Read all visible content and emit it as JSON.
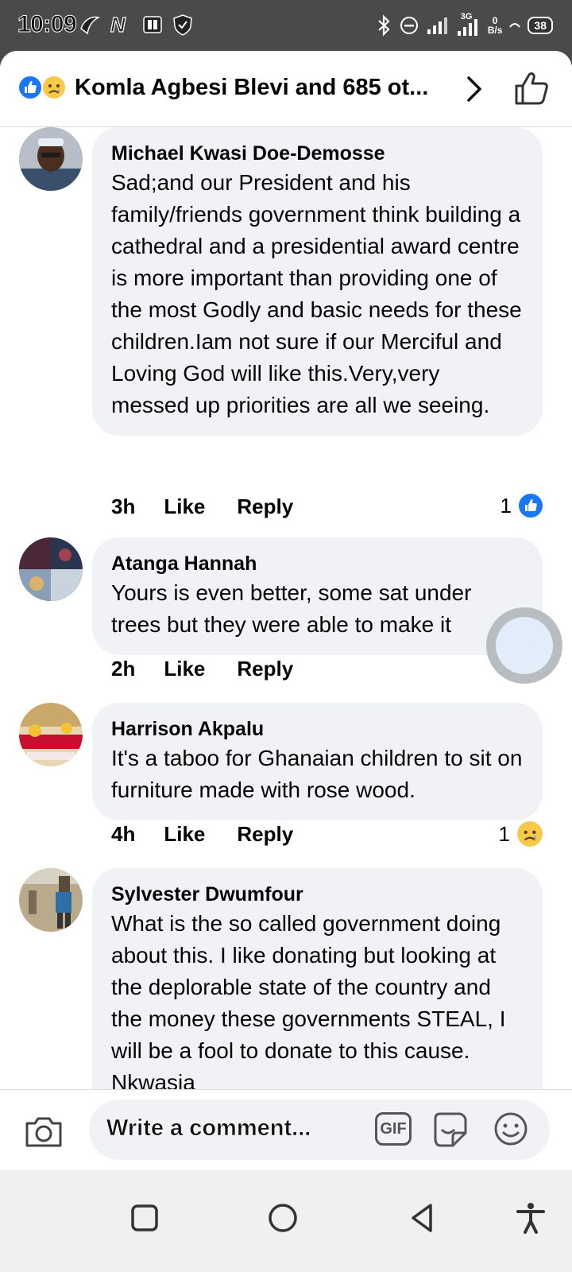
{
  "status_bar": {
    "time": "10:09",
    "network_type": "3G",
    "speed_value": "0",
    "speed_unit": "B/s",
    "battery": "38"
  },
  "header": {
    "title": "Komla Agbesi Blevi and 685 ot...",
    "icons": [
      "like-reaction-icon",
      "sad-reaction-icon",
      "chevron-right-icon",
      "thumbs-up-icon"
    ]
  },
  "comments": [
    {
      "author": "Michael Kwasi Doe-Demosse",
      "text": "Sad;and our President and his family/friends government think building a cathedral and a presidential award centre is more important than providing one of the most Godly and basic needs for these children.Iam not sure if our Merciful and Loving God will like this.Very,very messed up priorities are all we seeing.",
      "time": "3h",
      "like_label": "Like",
      "reply_label": "Reply",
      "reaction_count": "1",
      "reaction": "like"
    },
    {
      "author": "Atanga Hannah",
      "text": "Yours is even better, some sat under trees but they were able to make it",
      "time": "2h",
      "like_label": "Like",
      "reply_label": "Reply"
    },
    {
      "author": "Harrison Akpalu",
      "text": "It's a taboo for Ghanaian children to sit on furniture made with rose wood.",
      "time": "4h",
      "like_label": "Like",
      "reply_label": "Reply",
      "reaction_count": "1",
      "reaction": "sad"
    },
    {
      "author": "Sylvester Dwumfour",
      "text": "What is the so called government doing about this. I like donating but looking at the deplorable state of the country and the money these governments STEAL, I will be a fool to donate to this cause. Nkwasia"
    }
  ],
  "composer": {
    "placeholder": "Write a comment...",
    "gif_label": "GIF"
  },
  "colors": {
    "accent": "#1877f2",
    "bubble": "#f0f2f5",
    "status_bar": "#4a4a4a"
  }
}
